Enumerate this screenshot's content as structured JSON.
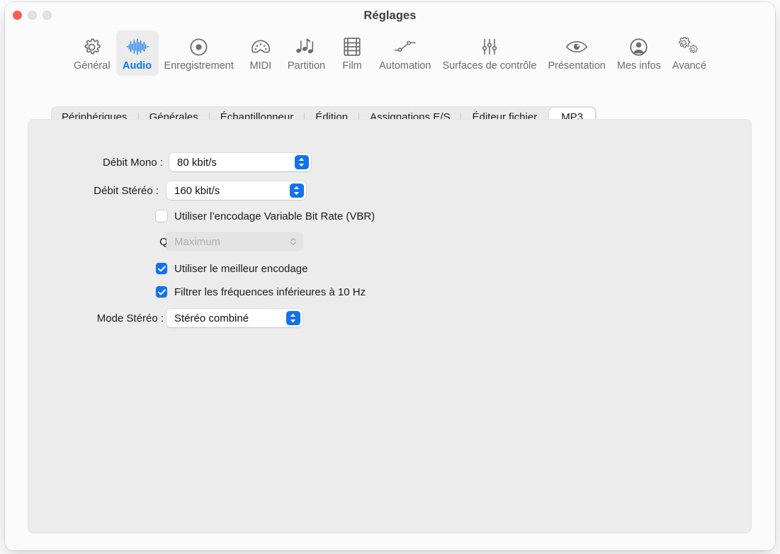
{
  "window": {
    "title": "Réglages",
    "traffic_lights": [
      {
        "name": "close",
        "color": "#fc6058"
      },
      {
        "name": "minimize",
        "color": "#e2e2e2"
      },
      {
        "name": "zoom",
        "color": "#e2e2e2"
      }
    ]
  },
  "toolbar": {
    "selected": "Audio",
    "accent_color": "#0a72f5",
    "items": [
      {
        "label": "Général",
        "icon": "gear-icon"
      },
      {
        "label": "Audio",
        "icon": "waveform-icon"
      },
      {
        "label": "Enregistrement",
        "icon": "record-circle-icon"
      },
      {
        "label": "MIDI",
        "icon": "midi-connector-icon"
      },
      {
        "label": "Partition",
        "icon": "music-notes-icon"
      },
      {
        "label": "Film",
        "icon": "film-strip-icon"
      },
      {
        "label": "Automation",
        "icon": "automation-curve-icon"
      },
      {
        "label": "Surfaces de contrôle",
        "icon": "sliders-icon"
      },
      {
        "label": "Présentation",
        "icon": "eye-icon"
      },
      {
        "label": "Mes infos",
        "icon": "person-circle-icon"
      },
      {
        "label": "Avancé",
        "icon": "double-gear-icon"
      }
    ]
  },
  "tabs": {
    "selected": "MP3",
    "items": [
      {
        "label": "Périphériques"
      },
      {
        "label": "Générales"
      },
      {
        "label": "Échantillonneur"
      },
      {
        "label": "Édition"
      },
      {
        "label": "Assignations E/S"
      },
      {
        "label": "Éditeur fichier"
      },
      {
        "label": "MP3"
      }
    ]
  },
  "mp3_settings": {
    "mono_bitrate": {
      "label": "Débit Mono :",
      "value": "80 kbit/s",
      "enabled": true
    },
    "stereo_bitrate": {
      "label": "Débit Stéréo :",
      "value": "160 kbit/s",
      "enabled": true
    },
    "vbr": {
      "label": "Utiliser l’encodage Variable Bit Rate (VBR)",
      "checked": false
    },
    "quality": {
      "label": "Qualité :",
      "value": "Maximum",
      "enabled": false
    },
    "best_encoding": {
      "label": "Utiliser le meilleur encodage",
      "checked": true
    },
    "filter_frequencies": {
      "label": "Filtrer les fréquences inférieures à 10 Hz",
      "checked": true
    },
    "stereo_mode": {
      "label": "Mode Stéréo :",
      "value": "Stéréo combiné",
      "enabled": true
    }
  }
}
